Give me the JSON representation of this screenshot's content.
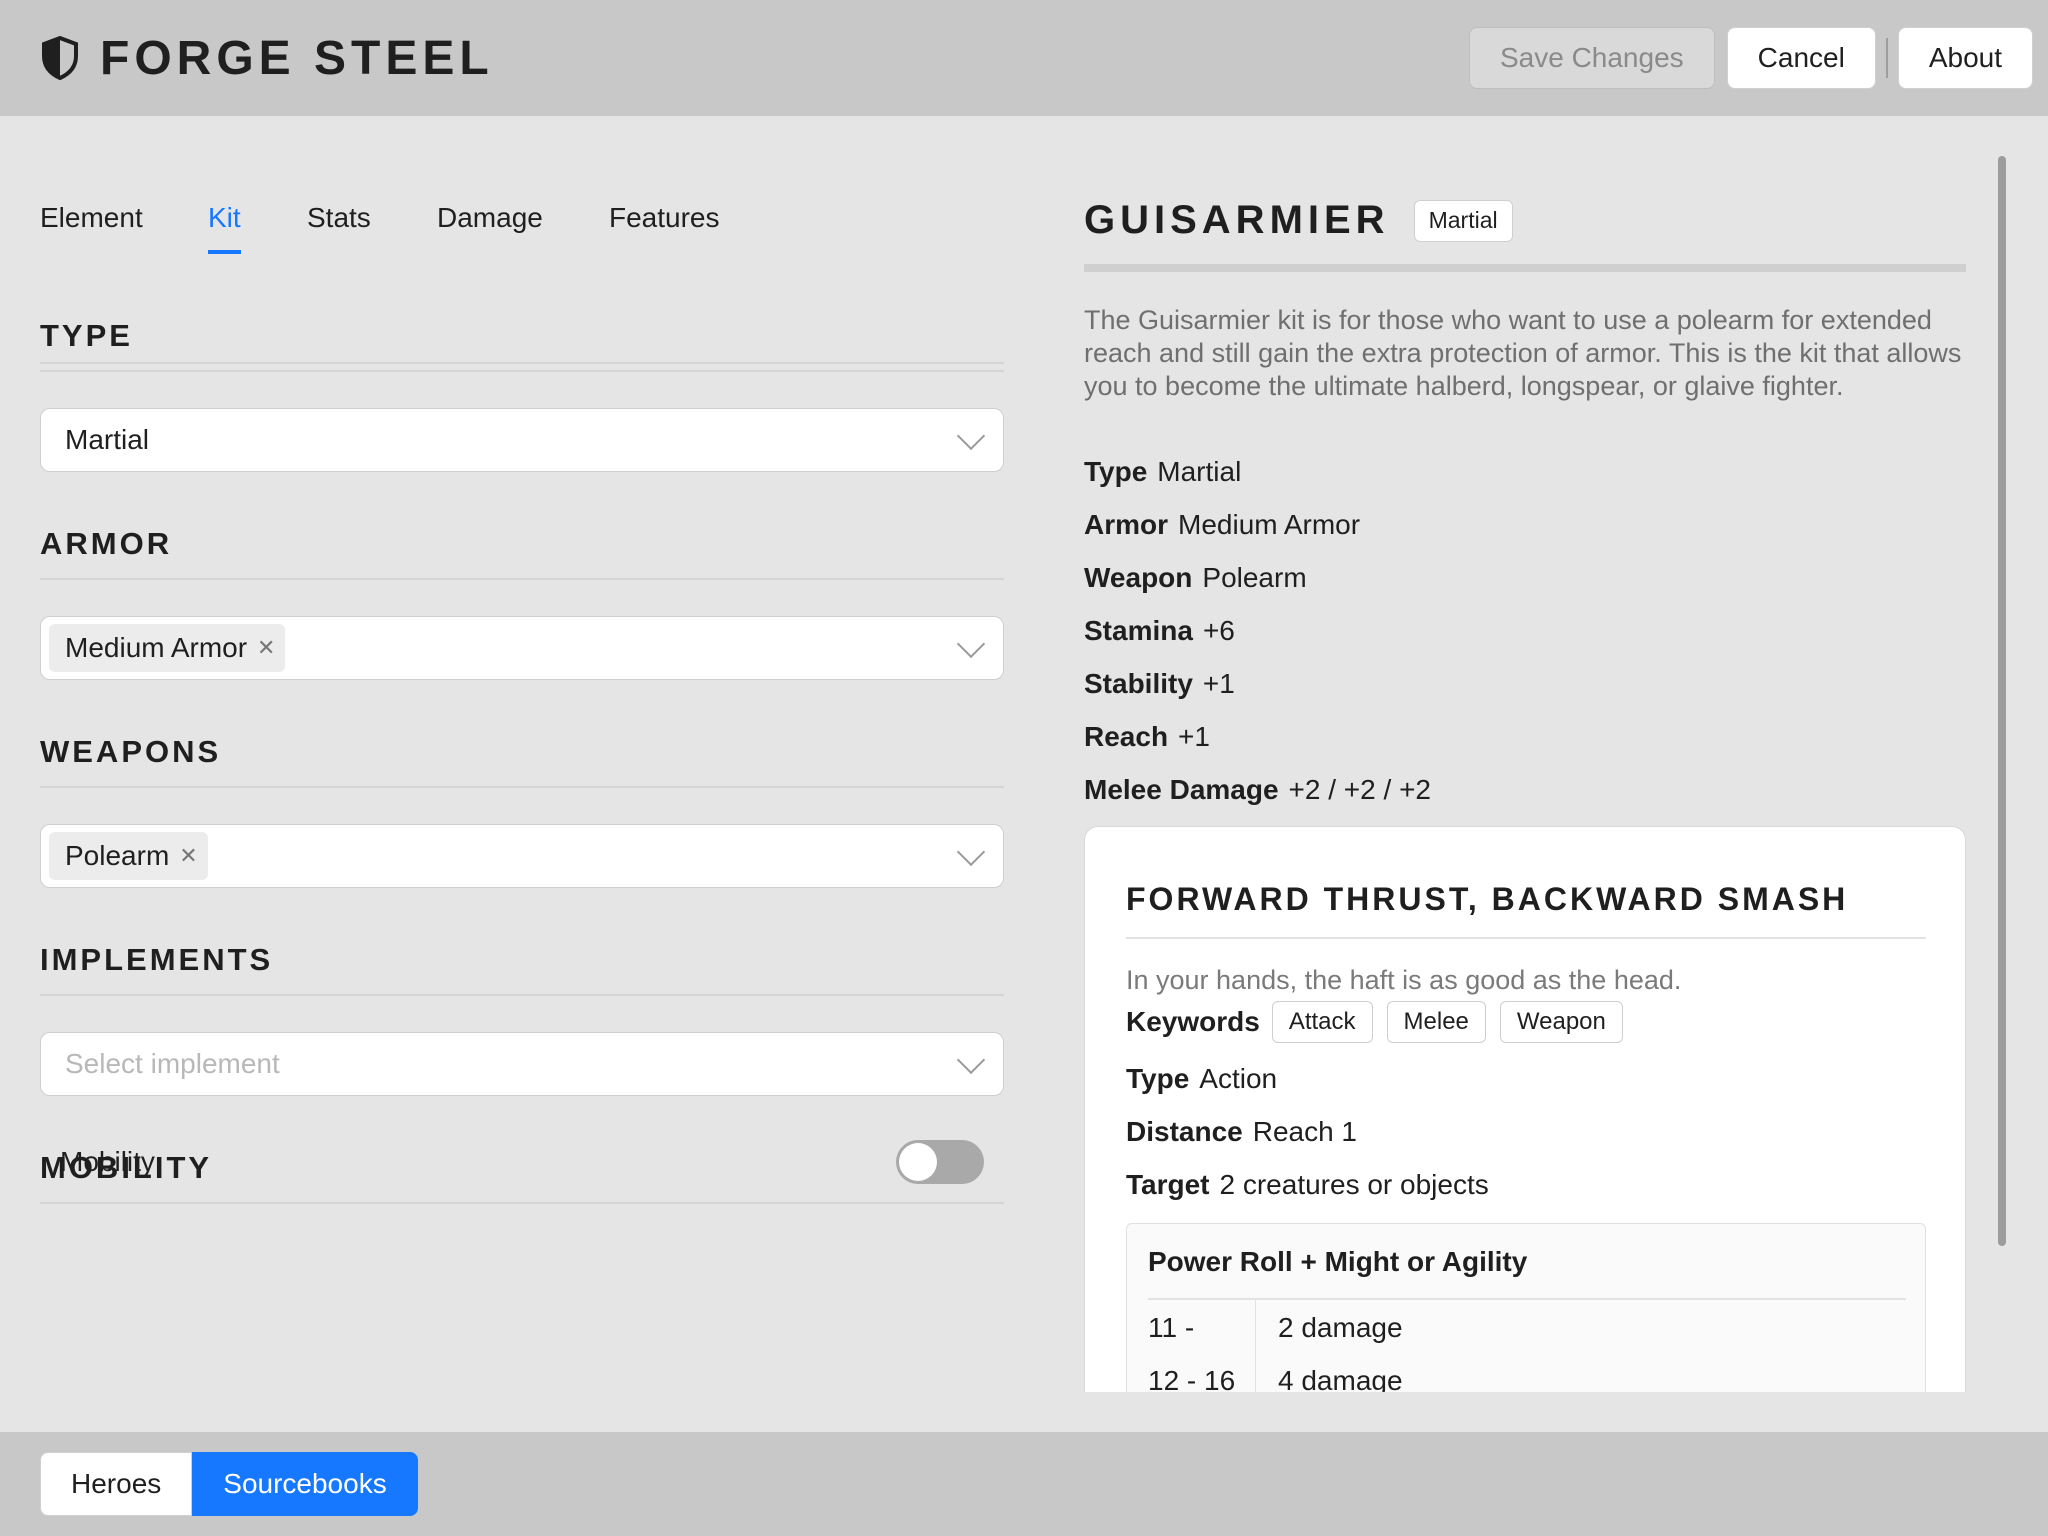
{
  "app": {
    "title": "FORGE STEEL"
  },
  "header": {
    "save_label": "Save Changes",
    "cancel_label": "Cancel",
    "about_label": "About"
  },
  "tabs": [
    {
      "label": "Element"
    },
    {
      "label": "Kit",
      "active": true
    },
    {
      "label": "Stats"
    },
    {
      "label": "Damage"
    },
    {
      "label": "Features"
    }
  ],
  "editor": {
    "type": {
      "title": "TYPE",
      "value": "Martial"
    },
    "armor": {
      "title": "ARMOR",
      "chips": [
        "Medium Armor"
      ]
    },
    "weapons": {
      "title": "WEAPONS",
      "chips": [
        "Polearm"
      ]
    },
    "implements": {
      "title": "IMPLEMENTS",
      "placeholder": "Select implement"
    },
    "mobility": {
      "title": "MOBILITY",
      "label": "Mobility",
      "enabled": false
    }
  },
  "preview": {
    "title": "GUISARMIER",
    "type_tag": "Martial",
    "description": "The Guisarmier kit is for those who want to use a polearm for extended reach and still gain the extra protection of armor. This is the kit that allows you to become the ultimate halberd, longspear, or glaive fighter.",
    "stats": [
      {
        "label": "Type",
        "value": "Martial"
      },
      {
        "label": "Armor",
        "value": "Medium Armor"
      },
      {
        "label": "Weapon",
        "value": "Polearm"
      },
      {
        "label": "Stamina",
        "value": "+6"
      },
      {
        "label": "Stability",
        "value": "+1"
      },
      {
        "label": "Reach",
        "value": "+1"
      },
      {
        "label": "Melee Damage",
        "value": "+2 / +2 / +2"
      }
    ],
    "ability": {
      "title": "FORWARD THRUST, BACKWARD SMASH",
      "flavor": "In your hands, the haft is as good as the head.",
      "keywords_label": "Keywords",
      "keywords": [
        "Attack",
        "Melee",
        "Weapon"
      ],
      "fields": [
        {
          "label": "Type",
          "value": "Action"
        },
        {
          "label": "Distance",
          "value": "Reach 1"
        },
        {
          "label": "Target",
          "value": "2 creatures or objects"
        }
      ],
      "power_roll": {
        "title": "Power Roll + Might or Agility",
        "tiers": [
          {
            "range": "11 -",
            "effect": "2 damage"
          },
          {
            "range": "12 - 16",
            "effect": "4 damage"
          }
        ]
      }
    }
  },
  "footer": {
    "heroes_label": "Heroes",
    "sourcebooks_label": "Sourcebooks"
  }
}
